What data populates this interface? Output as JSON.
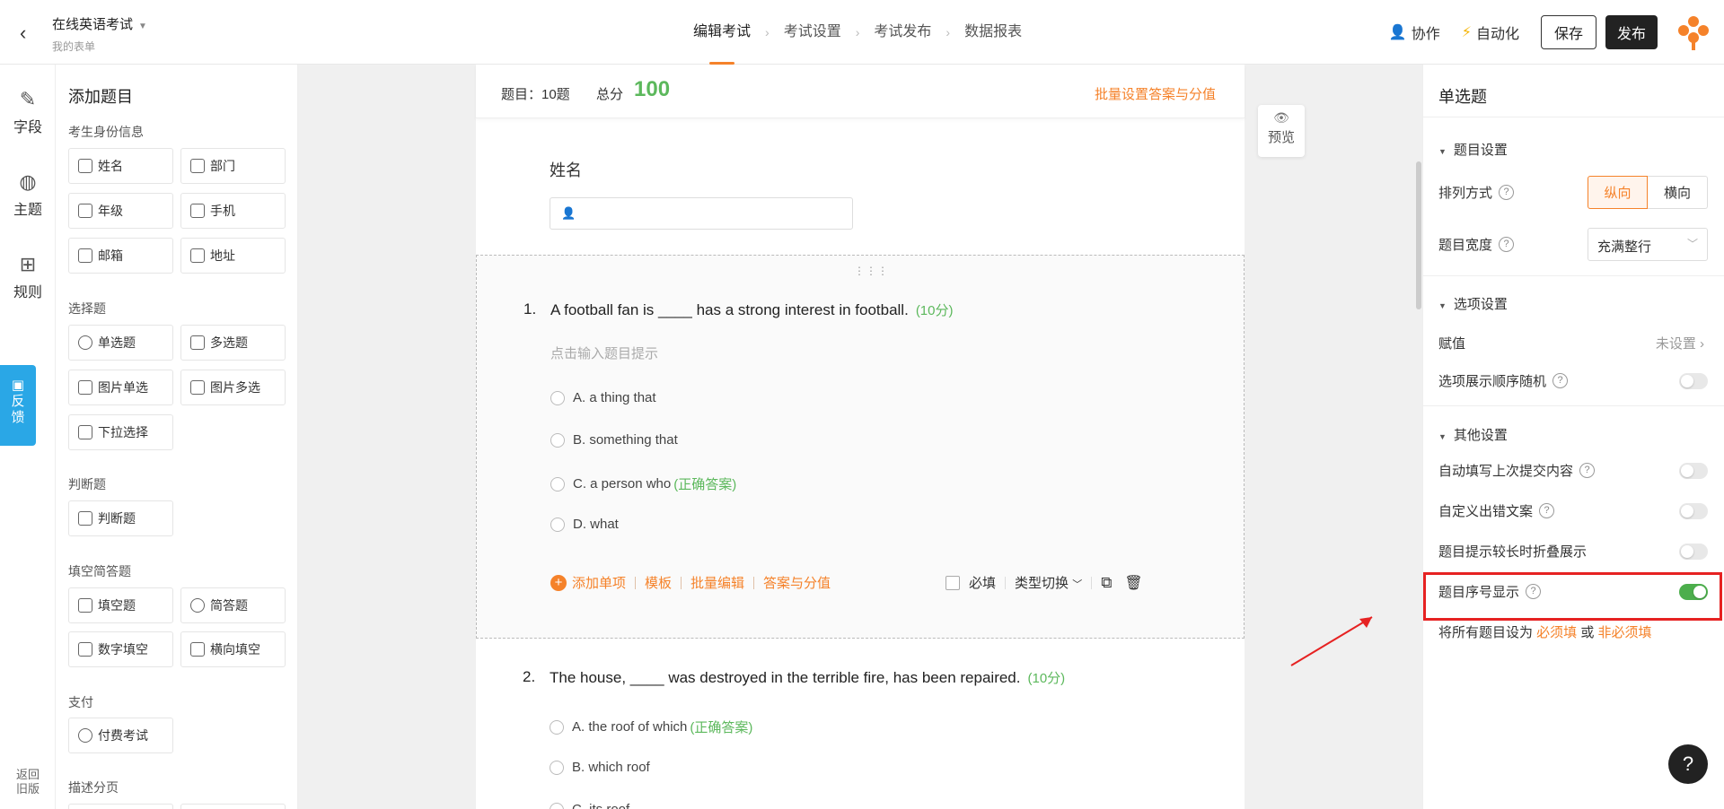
{
  "topbar": {
    "form_title": "在线英语考试",
    "form_sub": "我的表单",
    "steps": [
      "编辑考试",
      "考试设置",
      "考试发布",
      "数据报表"
    ],
    "collab": "协作",
    "automation": "自动化",
    "save": "保存",
    "publish": "发布"
  },
  "rail": {
    "field": "字段",
    "theme": "主题",
    "rules": "规则",
    "feedback1": "反",
    "feedback2": "馈",
    "old1": "返回",
    "old2": "旧版"
  },
  "left": {
    "title": "添加题目",
    "sections": {
      "identity": "考生身份信息",
      "choice": "选择题",
      "judge": "判断题",
      "blank": "填空简答题",
      "pay": "支付",
      "desc": "描述分页"
    },
    "identity_items": [
      "姓名",
      "部门",
      "年级",
      "手机",
      "邮箱",
      "地址"
    ],
    "choice_items": [
      "单选题",
      "多选题",
      "图片单选",
      "图片多选",
      "下拉选择"
    ],
    "judge_items": [
      "判断题"
    ],
    "blank_items": [
      "填空题",
      "简答题",
      "数字填空",
      "横向填空"
    ],
    "pay_items": [
      "付费考试"
    ]
  },
  "canvas": {
    "q_count_label": "题目：10题",
    "total_label": "总分",
    "total": "100",
    "batch": "批量设置答案与分值",
    "name_label": "姓名",
    "q1": {
      "num": "1.",
      "text": "A football fan is ____ has a strong interest in football.",
      "points": "(10分)",
      "hint": "点击输入题目提示",
      "options": [
        "A. a thing that",
        "B. something that",
        "C. a person who",
        "D. what"
      ],
      "correct_tag": "(正确答案)"
    },
    "q2": {
      "num": "2.",
      "text": "The house, ____ was destroyed in the terrible fire, has been repaired.",
      "points": "(10分)",
      "options": [
        "A. the roof of which",
        "B. which roof",
        "C. its roof"
      ],
      "correct_tag": "(正确答案)"
    },
    "tools": {
      "add": "添加单项",
      "template": "模板",
      "batch_edit": "批量编辑",
      "answer": "答案与分值",
      "required": "必填",
      "switch": "类型切换"
    },
    "preview": "预览"
  },
  "right": {
    "title": "单选题",
    "sec_q": "题目设置",
    "layout": "排列方式",
    "layout_on": "纵向",
    "layout_off": "横向",
    "width": "题目宽度",
    "width_val": "充满整行",
    "sec_opt": "选项设置",
    "assign": "赋值",
    "assign_val": "未设置 ›",
    "random": "选项展示顺序随机",
    "sec_other": "其他设置",
    "autofill": "自动填写上次提交内容",
    "custom_err": "自定义出错文案",
    "fold": "题目提示较长时折叠展示",
    "seq": "题目序号显示",
    "all_pre": "将所有题目设为 ",
    "all_req": "必须填",
    "all_or": " 或 ",
    "all_nreq": "非必须填"
  },
  "colors": {
    "accent": "#f5822a",
    "green": "#4cae4c",
    "highlight": "#e62222"
  }
}
